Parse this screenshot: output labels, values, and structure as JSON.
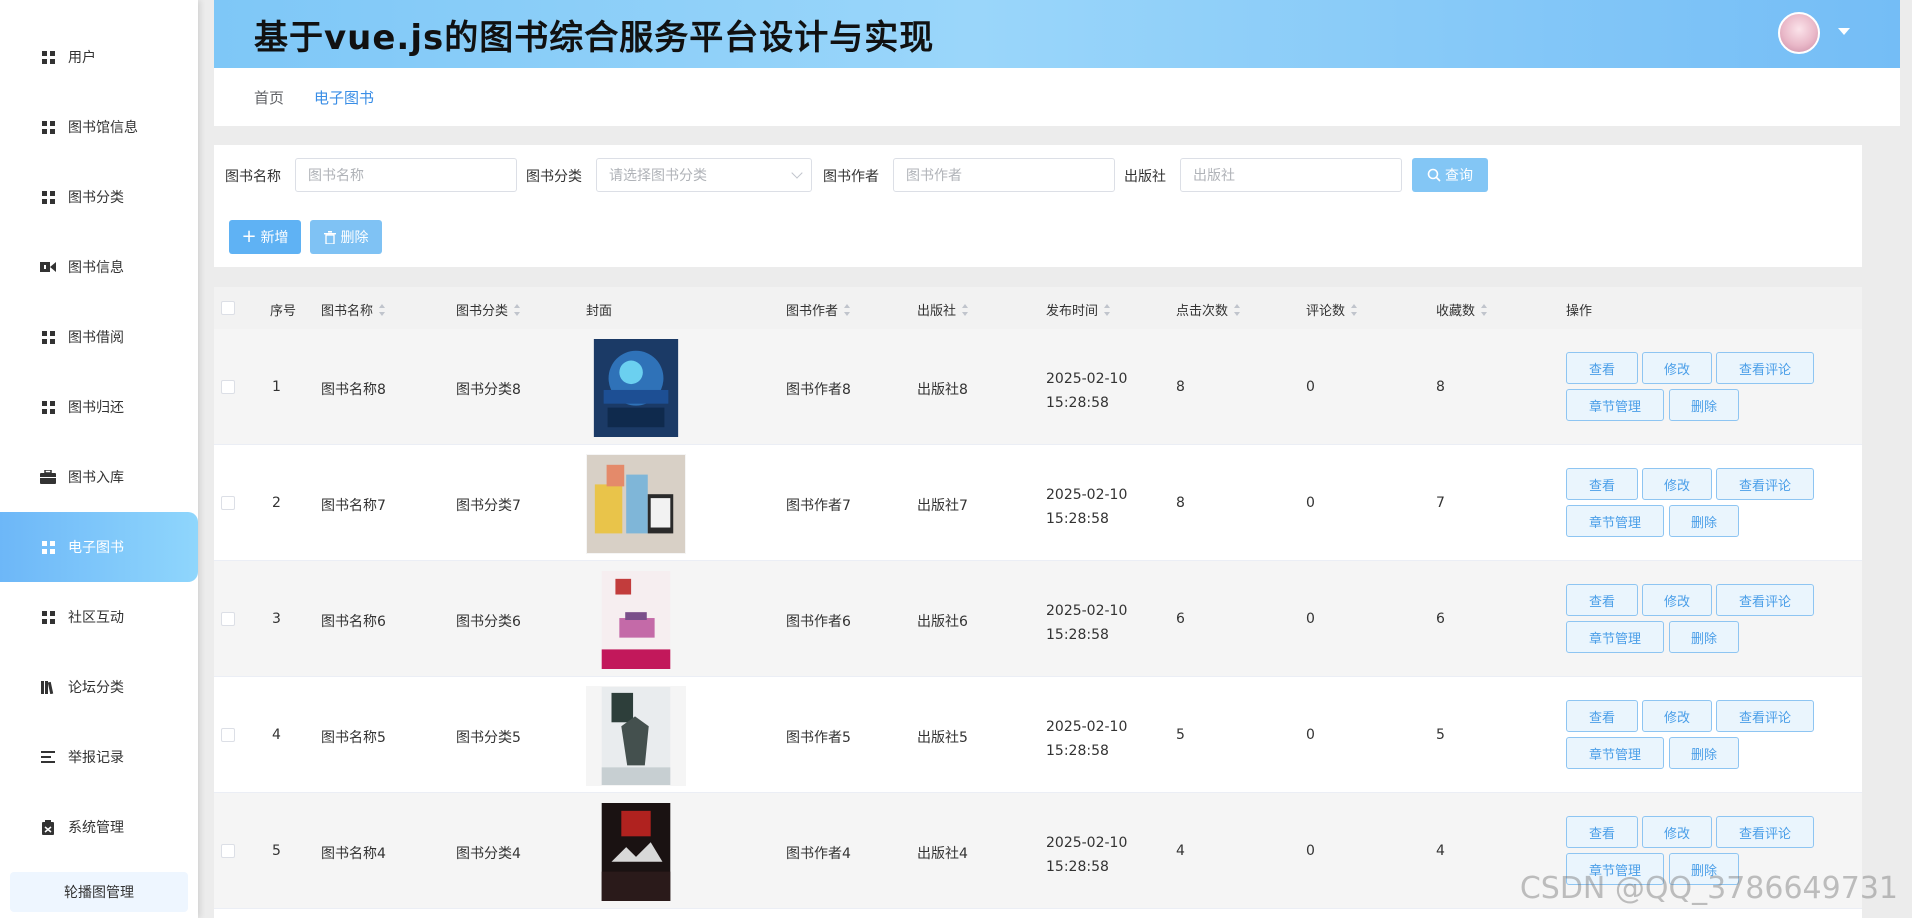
{
  "sidebar": {
    "items": [
      {
        "label": "用户",
        "icon": "grid-icon"
      },
      {
        "label": "图书馆信息",
        "icon": "grid-icon"
      },
      {
        "label": "图书分类",
        "icon": "grid-icon"
      },
      {
        "label": "图书信息",
        "icon": "ribbon-icon"
      },
      {
        "label": "图书借阅",
        "icon": "grid-icon"
      },
      {
        "label": "图书归还",
        "icon": "grid-icon"
      },
      {
        "label": "图书入库",
        "icon": "briefcase-icon"
      },
      {
        "label": "电子图书",
        "icon": "grid-icon",
        "active": true
      },
      {
        "label": "社区互动",
        "icon": "grid-icon"
      },
      {
        "label": "论坛分类",
        "icon": "bookshelf-icon"
      },
      {
        "label": "举报记录",
        "icon": "list-icon"
      },
      {
        "label": "系统管理",
        "icon": "clipboard-icon"
      }
    ],
    "sub_item": "轮播图管理"
  },
  "header": {
    "title": "基于vue.js的图书综合服务平台设计与实现"
  },
  "breadcrumb": {
    "home": "首页",
    "current": "电子图书"
  },
  "search": {
    "name_label": "图书名称",
    "name_placeholder": "图书名称",
    "category_label": "图书分类",
    "category_placeholder": "请选择图书分类",
    "author_label": "图书作者",
    "author_placeholder": "图书作者",
    "publisher_label": "出版社",
    "publisher_placeholder": "出版社",
    "query_button": "查询",
    "add_button": "新增",
    "delete_button": "删除"
  },
  "table": {
    "columns": {
      "index": "序号",
      "name": "图书名称",
      "category": "图书分类",
      "cover": "封面",
      "author": "图书作者",
      "publisher": "出版社",
      "time": "发布时间",
      "clicks": "点击次数",
      "comments": "评论数",
      "favorites": "收藏数",
      "actions": "操作"
    },
    "actions": {
      "view": "查看",
      "edit": "修改",
      "view_comments": "查看评论",
      "chapters": "章节管理",
      "delete": "删除"
    },
    "rows": [
      {
        "index": "1",
        "name": "图书名称8",
        "category": "图书分类8",
        "author": "图书作者8",
        "publisher": "出版社8",
        "time": "2025-02-10 15:28:58",
        "clicks": "8",
        "comments": "0",
        "favorites": "8"
      },
      {
        "index": "2",
        "name": "图书名称7",
        "category": "图书分类7",
        "author": "图书作者7",
        "publisher": "出版社7",
        "time": "2025-02-10 15:28:58",
        "clicks": "8",
        "comments": "0",
        "favorites": "7"
      },
      {
        "index": "3",
        "name": "图书名称6",
        "category": "图书分类6",
        "author": "图书作者6",
        "publisher": "出版社6",
        "time": "2025-02-10 15:28:58",
        "clicks": "6",
        "comments": "0",
        "favorites": "6"
      },
      {
        "index": "4",
        "name": "图书名称5",
        "category": "图书分类5",
        "author": "图书作者5",
        "publisher": "出版社5",
        "time": "2025-02-10 15:28:58",
        "clicks": "5",
        "comments": "0",
        "favorites": "5"
      },
      {
        "index": "5",
        "name": "图书名称4",
        "category": "图书分类4",
        "author": "图书作者4",
        "publisher": "出版社4",
        "time": "2025-02-10 15:28:58",
        "clicks": "4",
        "comments": "0",
        "favorites": "4"
      }
    ]
  },
  "watermark": "CSDN @QQ_3786649731",
  "colors": {
    "accent": "#5fb2f4",
    "header_start": "#7ec7f7",
    "header_end": "#74bdf6",
    "link": "#3a8ee6"
  }
}
